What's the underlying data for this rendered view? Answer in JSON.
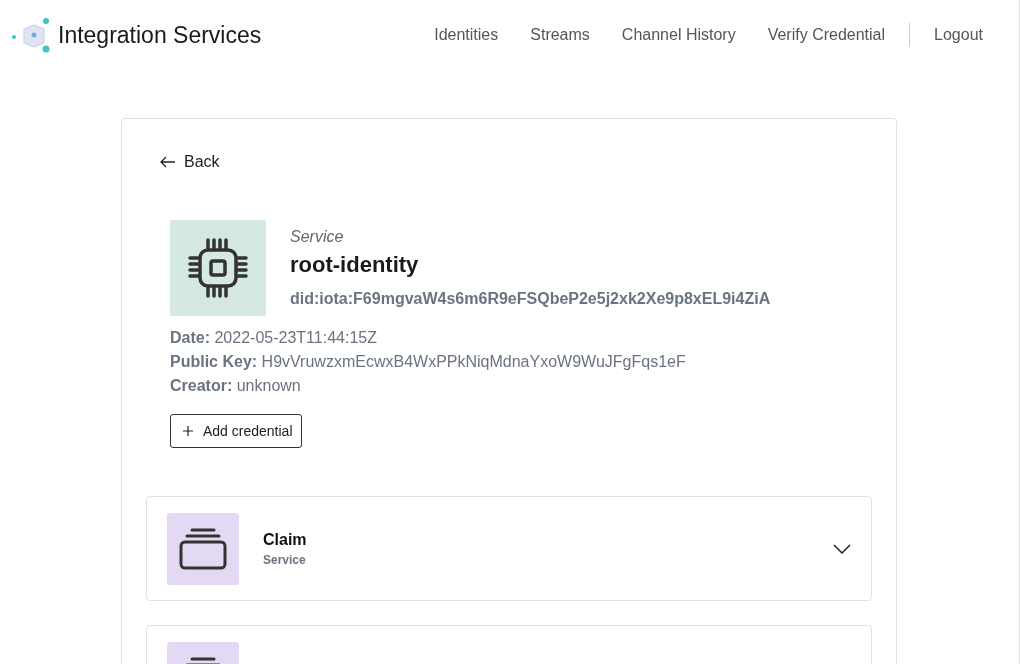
{
  "header": {
    "title": "Integration Services",
    "nav": [
      {
        "label": "Identities"
      },
      {
        "label": "Streams"
      },
      {
        "label": "Channel History"
      },
      {
        "label": "Verify Credential"
      }
    ],
    "logout": "Logout"
  },
  "back": "Back",
  "identity": {
    "type": "Service",
    "name": "root-identity",
    "did": "did:iota:F69mgvaW4s6m6R9eFSQbeP2e5j2xk2Xe9p8xEL9i4ZiA",
    "details": [
      "**Date:** 2022-05-23T11:44:15Z",
      "**Public Key:** H9vVruwzxmEcwxB4WxPPkNiqMdnaYxoW9WuJFgFqs1eF",
      "**Creator:** unknown"
    ]
  },
  "add_button": "Add credential",
  "credentials": [
    {
      "kind": "full",
      "title": "Claim",
      "subtitle": "Service",
      "expanded": false
    },
    {
      "kind": "partial"
    }
  ]
}
